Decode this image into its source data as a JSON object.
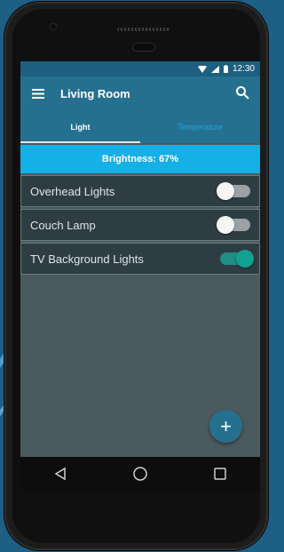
{
  "status_bar": {
    "time": "12:30"
  },
  "app_bar": {
    "title": "Living Room"
  },
  "tabs": [
    {
      "label": "Light",
      "active": true
    },
    {
      "label": "Temperature",
      "active": false
    }
  ],
  "brightness": {
    "label": "Brightness: 67%",
    "value": 67
  },
  "lights": [
    {
      "label": "Overhead Lights",
      "on": false
    },
    {
      "label": "Couch Lamp",
      "on": false
    },
    {
      "label": "TV Background Lights",
      "on": true
    }
  ],
  "fab": {
    "label": "+"
  },
  "icons": [
    "menu-icon",
    "search-icon",
    "wifi-icon",
    "signal-icon",
    "battery-icon",
    "back-icon",
    "home-icon",
    "recents-icon"
  ],
  "colors": {
    "primary": "#26708f",
    "accent": "#15b0e6",
    "toggle_on": "#14a090"
  }
}
